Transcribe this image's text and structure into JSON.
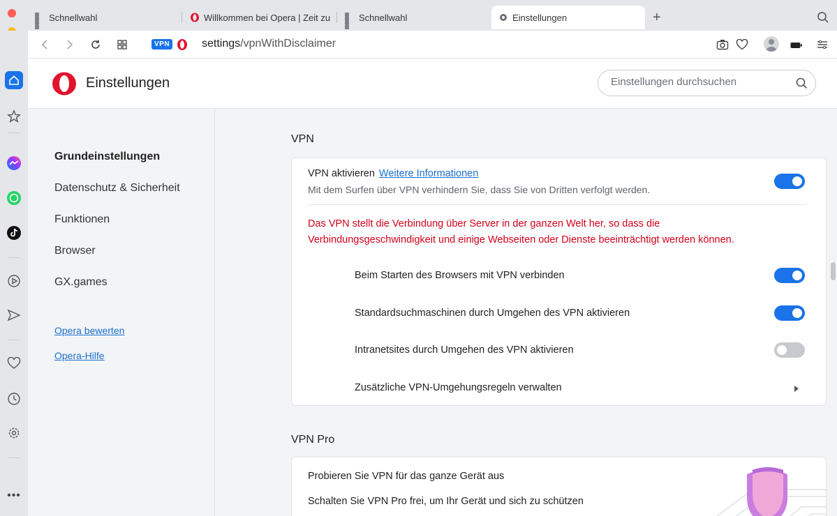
{
  "tabs": [
    {
      "label": "Schnellwahl"
    },
    {
      "label": "Willkommen bei Opera | Zeit zu"
    },
    {
      "label": "Schnellwahl"
    },
    {
      "label": "Einstellungen"
    }
  ],
  "new_tab_label": "+",
  "address": {
    "badge": "VPN",
    "url_host": "settings",
    "url_path": "/vpnWithDisclaimer"
  },
  "header": {
    "title": "Einstellungen",
    "search_placeholder": "Einstellungen durchsuchen"
  },
  "nav": {
    "items": [
      "Grundeinstellungen",
      "Datenschutz & Sicherheit",
      "Funktionen",
      "Browser",
      "GX.games"
    ],
    "links": [
      "Opera bewerten",
      "Opera-Hilfe"
    ]
  },
  "vpn": {
    "section_title": "VPN",
    "enable_label": "VPN aktivieren",
    "more_info_link": "Weitere Informationen",
    "enable_desc": "Mit dem Surfen über VPN verhindern Sie, dass Sie von Dritten verfolgt werden.",
    "enabled": true,
    "warning_line1": "Das VPN stellt die Verbindung über Server in der ganzen Welt her, so dass die",
    "warning_line2": "Verbindungsgeschwindigkeit und einige Webseiten oder Dienste beeinträchtigt werden können.",
    "options": [
      {
        "label": "Beim Starten des Browsers mit VPN verbinden",
        "on": true
      },
      {
        "label": "Standardsuchmaschinen durch Umgehen des VPN aktivieren",
        "on": true
      },
      {
        "label": "Intranetsites durch Umgehen des VPN aktivieren",
        "on": false
      }
    ],
    "bypass_rules_label": "Zusätzliche VPN-Umgehungsregeln verwalten"
  },
  "vpn_pro": {
    "section_title": "VPN Pro",
    "headline": "Probieren Sie VPN für das ganze Gerät aus",
    "desc": "Schalten Sie VPN Pro frei, um Ihr Gerät und sich zu schützen"
  },
  "colors": {
    "accent": "#1a73e8",
    "warning": "#d0021b",
    "opera_red": "#e2142d"
  },
  "sidebar_icons": [
    "home-icon",
    "star-icon",
    "messenger-icon",
    "whatsapp-icon",
    "tiktok-icon",
    "player-icon",
    "send-icon",
    "heart-icon",
    "history-icon",
    "settings-icon",
    "more-icon"
  ]
}
